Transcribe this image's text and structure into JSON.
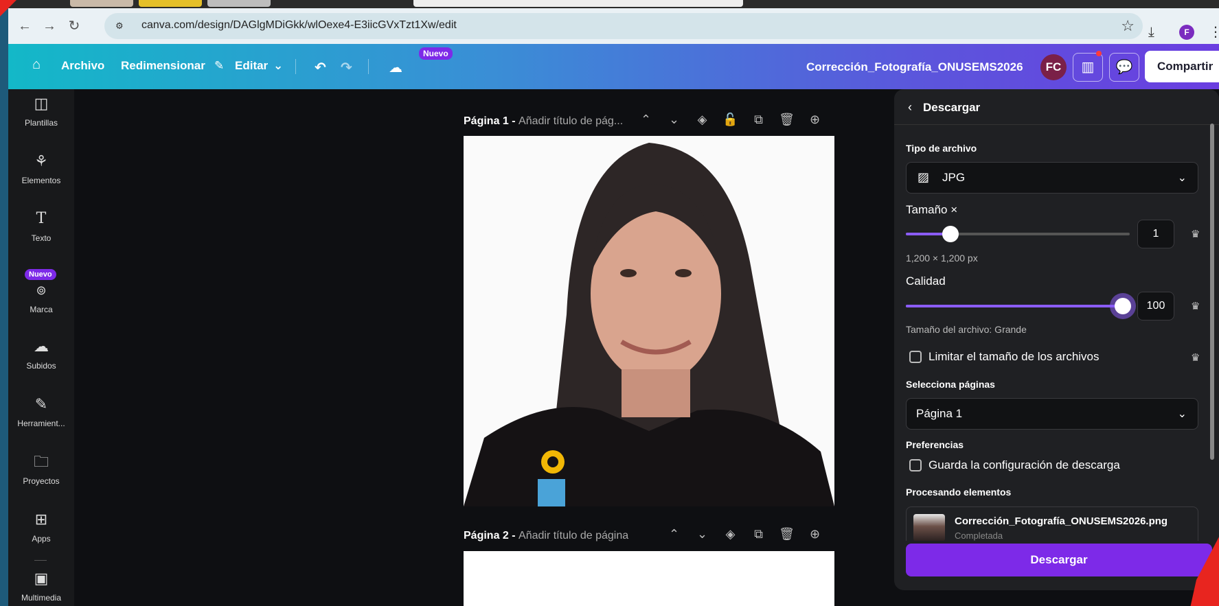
{
  "browser": {
    "url": "canva.com/design/DAGlgMDiGkk/wlOexe4-E3iicGVxTzt1Xw/edit",
    "profile_initial": "F"
  },
  "header": {
    "archivo": "Archivo",
    "redimensionar": "Redimensionar",
    "editar": "Editar",
    "nuevo_badge": "Nuevo",
    "design_title": "Corrección_Fotografía_ONUSEMS2026",
    "avatar_initials": "FC",
    "share_label": "Compartir"
  },
  "sidebar": {
    "items": [
      {
        "label": "Plantillas",
        "icon": "templates-icon"
      },
      {
        "label": "Elementos",
        "icon": "elements-icon"
      },
      {
        "label": "Texto",
        "icon": "text-icon"
      },
      {
        "label": "Marca",
        "icon": "brand-icon"
      },
      {
        "label": "Subidos",
        "icon": "uploads-icon"
      },
      {
        "label": "Herramient...",
        "icon": "tools-icon"
      },
      {
        "label": "Proyectos",
        "icon": "projects-icon"
      },
      {
        "label": "Apps",
        "icon": "apps-icon"
      },
      {
        "label": "Multimedia",
        "icon": "media-icon"
      }
    ],
    "nuevo_badge": "Nuevo"
  },
  "canvas": {
    "page1_label": "Página 1 - ",
    "page1_title_placeholder": "Añadir título de pág...",
    "page2_label": "Página 2 - ",
    "page2_title_placeholder": "Añadir título de página"
  },
  "download_panel": {
    "title": "Descargar",
    "file_type_label": "Tipo de archivo",
    "file_type_value": "JPG",
    "size_label": "Tamaño ×",
    "size_value": "1",
    "size_fraction": 0.2,
    "size_dimensions": "1,200 × 1,200 px",
    "quality_label": "Calidad",
    "quality_value": "100",
    "quality_fraction": 1.0,
    "file_size_hint": "Tamaño del archivo: Grande",
    "limit_size_label": "Limitar el tamaño de los archivos",
    "pages_label": "Selecciona páginas",
    "pages_value": "Página 1",
    "preferences_label": "Preferencias",
    "save_config_label": "Guarda la configuración de descarga",
    "processing_label": "Procesando elementos",
    "processing_file": "Corrección_Fotografía_ONUSEMS2026.png",
    "processing_status": "Completada",
    "download_button": "Descargar"
  },
  "colors": {
    "accent": "#7d2ae8",
    "header_gradient_start": "#13b8c8",
    "header_gradient_end": "#6a3ee0"
  }
}
